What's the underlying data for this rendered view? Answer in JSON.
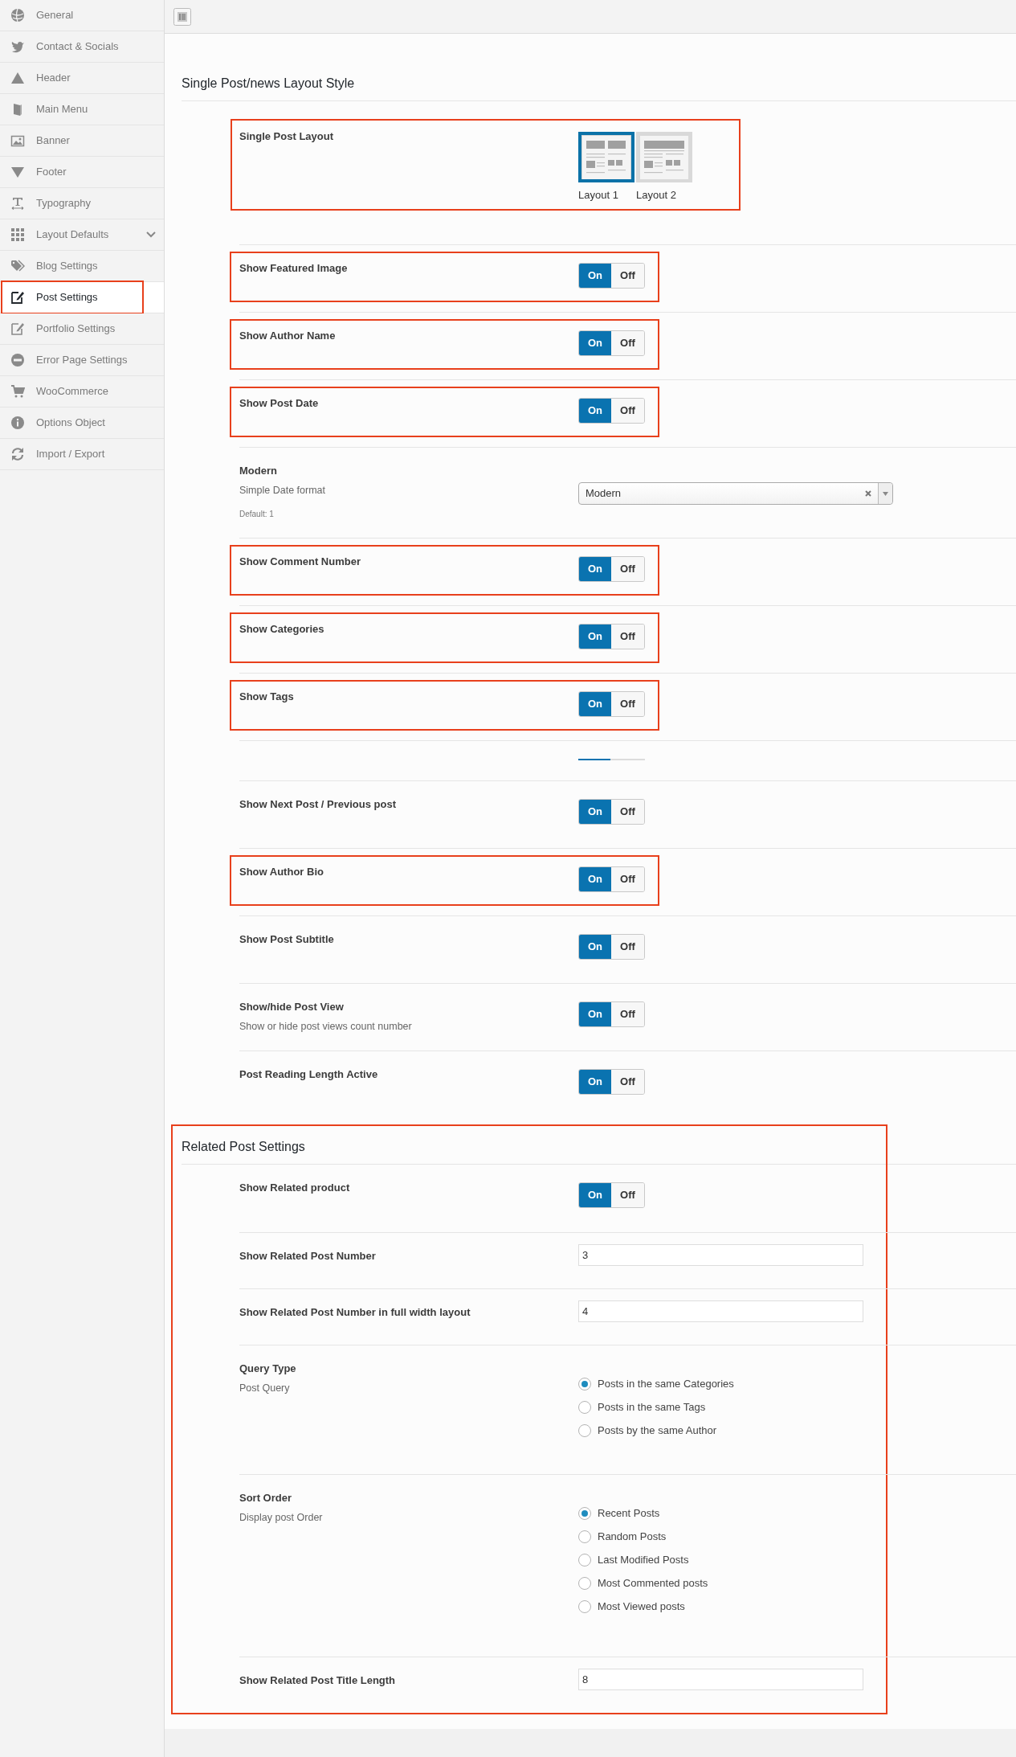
{
  "sidebar": {
    "items": [
      {
        "label": "General",
        "selected": false,
        "has_submenu": false
      },
      {
        "label": "Contact & Socials",
        "selected": false,
        "has_submenu": false
      },
      {
        "label": "Header",
        "selected": false,
        "has_submenu": false
      },
      {
        "label": "Main Menu",
        "selected": false,
        "has_submenu": false
      },
      {
        "label": "Banner",
        "selected": false,
        "has_submenu": false
      },
      {
        "label": "Footer",
        "selected": false,
        "has_submenu": false
      },
      {
        "label": "Typography",
        "selected": false,
        "has_submenu": false
      },
      {
        "label": "Layout Defaults",
        "selected": false,
        "has_submenu": true
      },
      {
        "label": "Blog Settings",
        "selected": false,
        "has_submenu": false
      },
      {
        "label": "Post Settings",
        "selected": true,
        "has_submenu": false,
        "highlighted": true
      },
      {
        "label": "Portfolio Settings",
        "selected": false,
        "has_submenu": false
      },
      {
        "label": "Error Page Settings",
        "selected": false,
        "has_submenu": false
      },
      {
        "label": "WooCommerce",
        "selected": false,
        "has_submenu": false
      },
      {
        "label": "Options Object",
        "selected": false,
        "has_submenu": false
      },
      {
        "label": "Import / Export",
        "selected": false,
        "has_submenu": false
      }
    ]
  },
  "sections": [
    {
      "title": "Single Post/news Layout Style",
      "highlighted": false,
      "rows": [
        {
          "kind": "image_select",
          "label": "Single Post Layout",
          "highlighted": true,
          "options": [
            {
              "label": "Layout 1",
              "selected": true
            },
            {
              "label": "Layout 2",
              "selected": false
            }
          ]
        },
        {
          "kind": "toggle",
          "label": "Show Featured Image",
          "highlighted": true,
          "on": true,
          "on_label": "On",
          "off_label": "Off"
        },
        {
          "kind": "toggle",
          "label": "Show Author Name",
          "highlighted": true,
          "on": true,
          "on_label": "On",
          "off_label": "Off"
        },
        {
          "kind": "toggle",
          "label": "Show Post Date",
          "highlighted": true,
          "on": true,
          "on_label": "On",
          "off_label": "Off"
        },
        {
          "kind": "select",
          "label": "Modern",
          "description": "Simple Date format",
          "default_note": "Default: 1",
          "highlighted": false,
          "value": "Modern"
        },
        {
          "kind": "toggle",
          "label": "Show Comment Number",
          "highlighted": true,
          "on": true,
          "on_label": "On",
          "off_label": "Off"
        },
        {
          "kind": "toggle",
          "label": "Show Categories",
          "highlighted": true,
          "on": true,
          "on_label": "On",
          "off_label": "Off"
        },
        {
          "kind": "toggle",
          "label": "Show Tags",
          "highlighted": true,
          "on": true,
          "on_label": "On",
          "off_label": "Off"
        },
        {
          "kind": "collapsed",
          "highlighted": false
        },
        {
          "kind": "toggle",
          "label": "Show Next Post / Previous post",
          "highlighted": false,
          "on": true,
          "on_label": "On",
          "off_label": "Off"
        },
        {
          "kind": "toggle",
          "label": "Show Author Bio",
          "highlighted": true,
          "on": true,
          "on_label": "On",
          "off_label": "Off"
        },
        {
          "kind": "toggle",
          "label": "Show Post Subtitle",
          "highlighted": false,
          "on": true,
          "on_label": "On",
          "off_label": "Off"
        },
        {
          "kind": "toggle",
          "label": "Show/hide Post View",
          "description": "Show or hide post views count number",
          "highlighted": false,
          "on": true,
          "on_label": "On",
          "off_label": "Off"
        },
        {
          "kind": "toggle",
          "label": "Post Reading Length Active",
          "highlighted": false,
          "on": true,
          "on_label": "On",
          "off_label": "Off"
        }
      ]
    },
    {
      "title": "Related Post Settings",
      "highlighted": true,
      "rows": [
        {
          "kind": "toggle",
          "label": "Show Related product",
          "highlighted": false,
          "on": true,
          "on_label": "On",
          "off_label": "Off"
        },
        {
          "kind": "text",
          "label": "Show Related Post Number",
          "highlighted": false,
          "value": "3"
        },
        {
          "kind": "text",
          "label": "Show Related Post Number in full width layout",
          "highlighted": false,
          "value": "4"
        },
        {
          "kind": "radio",
          "label": "Query Type",
          "description": "Post Query",
          "highlighted": false,
          "options": [
            {
              "label": "Posts in the same Categories",
              "selected": true
            },
            {
              "label": "Posts in the same Tags",
              "selected": false
            },
            {
              "label": "Posts by the same Author",
              "selected": false
            }
          ]
        },
        {
          "kind": "radio",
          "label": "Sort Order",
          "description": "Display post Order",
          "highlighted": false,
          "options": [
            {
              "label": "Recent Posts",
              "selected": true
            },
            {
              "label": "Random Posts",
              "selected": false
            },
            {
              "label": "Last Modified Posts",
              "selected": false
            },
            {
              "label": "Most Commented posts",
              "selected": false
            },
            {
              "label": "Most Viewed posts",
              "selected": false
            }
          ]
        },
        {
          "kind": "text",
          "label": "Show Related Post Title Length",
          "highlighted": false,
          "value": "8"
        }
      ]
    }
  ]
}
